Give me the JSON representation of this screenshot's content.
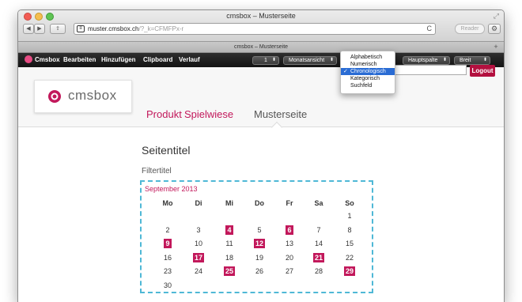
{
  "browser": {
    "window_title": "cmsbox – Musterseite",
    "tab_title": "cmsbox – Musterseite",
    "url_host": "muster.cmsbox.ch",
    "url_rest": "/?_k=CFMFPx-r",
    "reader_label": "Reader",
    "back_glyph": "◀",
    "forward_glyph": "▶",
    "share_glyph": "⇪",
    "reload_glyph": "C",
    "plus_glyph": "+"
  },
  "cms_toolbar": {
    "items": [
      "Cmsbox",
      "Bearbeiten",
      "Hinzufügen",
      "Clipboard",
      "Verlauf"
    ],
    "page_select": "1",
    "view_select": "Monatsansicht",
    "column_select": "Hauptspalte",
    "width_select": "Breit",
    "search_placeholder": "uchen",
    "logout_label": "Logout"
  },
  "dropdown": {
    "options": [
      "Alphabetisch",
      "Numerisch",
      "Chronologisch",
      "Kategorisch",
      "Suchfeld"
    ],
    "selected_index": 2
  },
  "site": {
    "logo_text": "cmsbox",
    "nav": [
      "Produkt",
      "Spielwiese",
      "Musterseite"
    ],
    "active_nav_index": 2,
    "page_title": "Seitentitel",
    "filter_title": "Filtertitel"
  },
  "calendar": {
    "month_label": "September 2013",
    "weekdays": [
      "Mo",
      "Di",
      "Mi",
      "Do",
      "Fr",
      "Sa",
      "So"
    ],
    "weeks": [
      [
        "",
        "",
        "",
        "",
        "",
        "",
        "1"
      ],
      [
        "2",
        "3",
        "4",
        "5",
        "6",
        "7",
        "8"
      ],
      [
        "9",
        "10",
        "11",
        "12",
        "13",
        "14",
        "15"
      ],
      [
        "16",
        "17",
        "18",
        "19",
        "20",
        "21",
        "22"
      ],
      [
        "23",
        "24",
        "25",
        "26",
        "27",
        "28",
        "29"
      ],
      [
        "30",
        "",
        "",
        "",
        "",
        "",
        ""
      ]
    ],
    "event_days": [
      "4",
      "6",
      "9",
      "12",
      "17",
      "21",
      "25",
      "29"
    ]
  },
  "colors": {
    "accent": "#c2185b",
    "logout": "#b3103f",
    "calendar_border": "#4fb8d6",
    "selected_option": "#2a6cd4"
  }
}
